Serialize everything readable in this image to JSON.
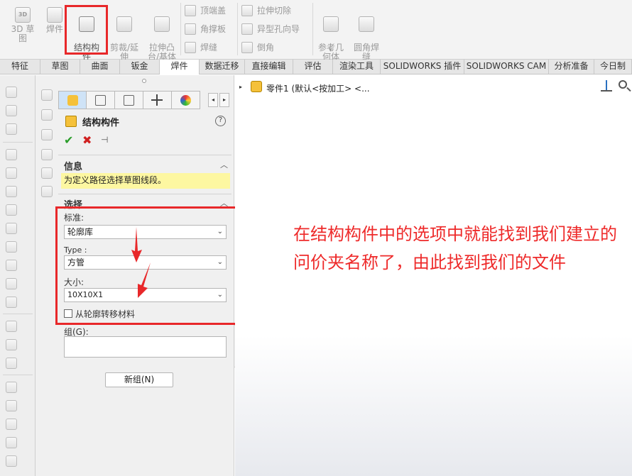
{
  "ribbon": {
    "buttons": [
      {
        "label": "3D 草图",
        "icon": "3d-sketch-icon",
        "icon_text": "3D"
      },
      {
        "label": "焊件",
        "icon": "weldment-icon"
      },
      {
        "label": "结构构\n件",
        "icon": "structural-member-icon"
      },
      {
        "label": "剪裁/延\n伸",
        "icon": "trim-extend-icon"
      },
      {
        "label": "拉伸凸\n台/基体",
        "icon": "extruded-boss-icon"
      },
      {
        "label": "参考几\n何体",
        "icon": "reference-geometry-icon"
      },
      {
        "label": "圆角焊\n缝",
        "icon": "fillet-bead-icon"
      }
    ],
    "small_items": [
      {
        "label": "顶端盖",
        "icon": "end-cap-icon"
      },
      {
        "label": "角撑板",
        "icon": "gusset-icon"
      },
      {
        "label": "焊缝",
        "icon": "weld-bead-icon"
      },
      {
        "label": "拉伸切除",
        "icon": "extruded-cut-icon"
      },
      {
        "label": "异型孔向导",
        "icon": "hole-wizard-icon"
      },
      {
        "label": "倒角",
        "icon": "chamfer-icon"
      }
    ],
    "dropdown_glyph": "▾"
  },
  "tabs": [
    "特征",
    "草图",
    "曲面",
    "钣金",
    "焊件",
    "数据迁移",
    "直接编辑",
    "评估",
    "渲染工具",
    "SOLIDWORKS 插件",
    "SOLIDWORKS CAM",
    "分析准备",
    "今日制"
  ],
  "active_tab": "焊件",
  "property_manager": {
    "title": "结构构件",
    "help": "?",
    "ok": "✔",
    "cancel": "✖",
    "pin": "⊣",
    "nav_prev": "◂",
    "nav_next": "▸",
    "info": {
      "title": "信息",
      "collapse": "︿",
      "message": "为定义路径选择草图线段。"
    },
    "selection": {
      "title": "选择",
      "collapse": "︿",
      "standard_label": "标准:",
      "standard_value": "轮廓库",
      "type_label": "Type :",
      "type_value": "方管",
      "size_label": "大小:",
      "size_value": "10X10X1",
      "chevron": "⌄",
      "transfer_material_label": "从轮廓转移材料",
      "group_label": "组(G):",
      "new_group_label": "新组(N)"
    }
  },
  "graphics": {
    "tree_caret": "▸",
    "tree_item": "零件1 (默认<按加工> <..."
  },
  "annotation": "在结构构件中的选项中就能找到我们建立的问价夹名称了，由此找到我们的文件",
  "colors": {
    "highlight_red": "#e8282a",
    "info_yellow": "#fdf7a1",
    "feature_gold": "#f5c13a"
  }
}
